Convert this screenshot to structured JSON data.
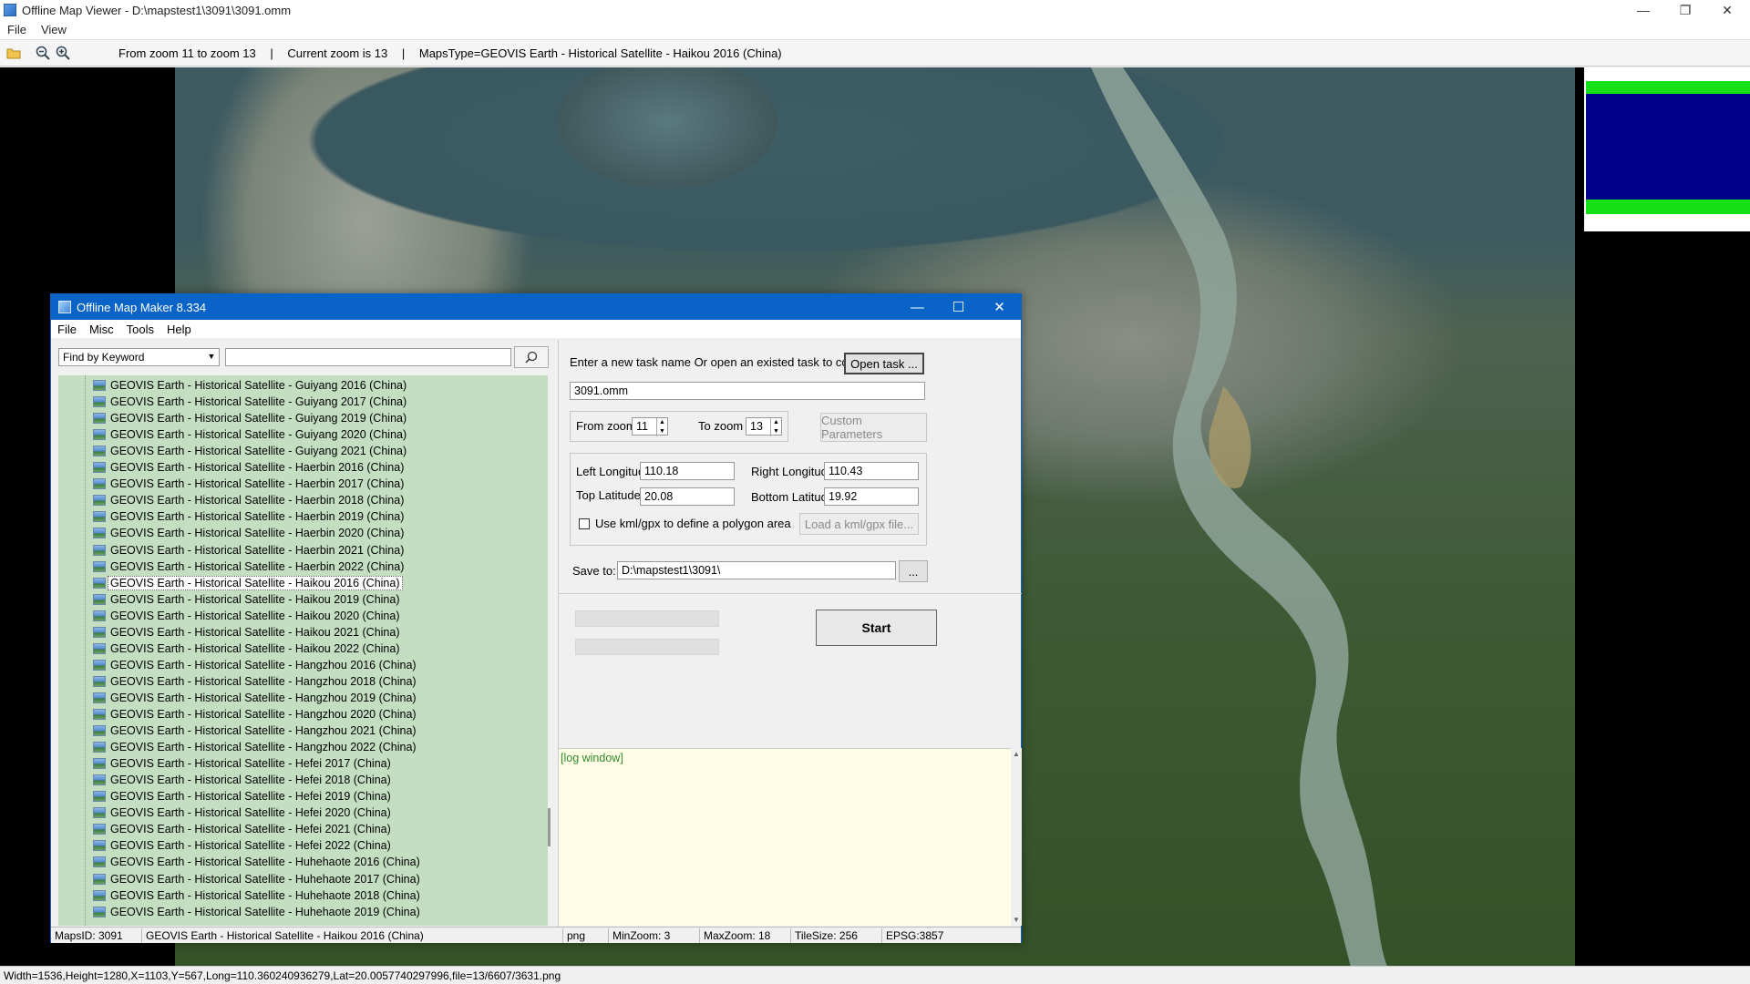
{
  "viewer": {
    "title": "Offline Map Viewer - D:\\mapstest1\\3091\\3091.omm",
    "menu": [
      "File",
      "View"
    ],
    "toolbar": {
      "zoom_range": "From zoom 11 to zoom 13",
      "current_zoom": "Current zoom is 13",
      "maps_type": "MapsType=GEOVIS Earth - Historical Satellite - Haikou 2016 (China)",
      "sep": "|"
    },
    "status": "Width=1536,Height=1280,X=1103,Y=567,Long=110.360240936279,Lat=20.0057740297996,file=13/6607/3631.png",
    "controls": {
      "minimize": "—",
      "restore": "❐",
      "close": "✕"
    }
  },
  "dialog": {
    "title": "Offline Map Maker 8.334",
    "menu": [
      "File",
      "Misc",
      "Tools",
      "Help"
    ],
    "search_mode": "Find by Keyword",
    "map_list": [
      "GEOVIS Earth - Historical Satellite - Guiyang 2016 (China)",
      "GEOVIS Earth - Historical Satellite - Guiyang 2017 (China)",
      "GEOVIS Earth - Historical Satellite - Guiyang 2019 (China)",
      "GEOVIS Earth - Historical Satellite - Guiyang 2020 (China)",
      "GEOVIS Earth - Historical Satellite - Guiyang 2021 (China)",
      "GEOVIS Earth - Historical Satellite - Haerbin 2016 (China)",
      "GEOVIS Earth - Historical Satellite - Haerbin 2017 (China)",
      "GEOVIS Earth - Historical Satellite - Haerbin 2018 (China)",
      "GEOVIS Earth - Historical Satellite - Haerbin 2019 (China)",
      "GEOVIS Earth - Historical Satellite - Haerbin 2020 (China)",
      "GEOVIS Earth - Historical Satellite - Haerbin 2021 (China)",
      "GEOVIS Earth - Historical Satellite - Haerbin 2022 (China)",
      "GEOVIS Earth - Historical Satellite - Haikou 2016 (China)",
      "GEOVIS Earth - Historical Satellite - Haikou 2019 (China)",
      "GEOVIS Earth - Historical Satellite - Haikou 2020 (China)",
      "GEOVIS Earth - Historical Satellite - Haikou 2021 (China)",
      "GEOVIS Earth - Historical Satellite - Haikou 2022 (China)",
      "GEOVIS Earth - Historical Satellite - Hangzhou 2016 (China)",
      "GEOVIS Earth - Historical Satellite - Hangzhou 2018 (China)",
      "GEOVIS Earth - Historical Satellite - Hangzhou 2019 (China)",
      "GEOVIS Earth - Historical Satellite - Hangzhou 2020 (China)",
      "GEOVIS Earth - Historical Satellite - Hangzhou 2021 (China)",
      "GEOVIS Earth - Historical Satellite - Hangzhou 2022 (China)",
      "GEOVIS Earth - Historical Satellite - Hefei 2017 (China)",
      "GEOVIS Earth - Historical Satellite - Hefei 2018 (China)",
      "GEOVIS Earth - Historical Satellite - Hefei 2019 (China)",
      "GEOVIS Earth - Historical Satellite - Hefei 2020 (China)",
      "GEOVIS Earth - Historical Satellite - Hefei 2021 (China)",
      "GEOVIS Earth - Historical Satellite - Hefei 2022 (China)",
      "GEOVIS Earth - Historical Satellite - Huhehaote 2016 (China)",
      "GEOVIS Earth - Historical Satellite - Huhehaote 2017 (China)",
      "GEOVIS Earth - Historical Satellite - Huhehaote 2018 (China)",
      "GEOVIS Earth - Historical Satellite - Huhehaote 2019 (China)"
    ],
    "selected_index": 12,
    "task_prompt": "Enter a new task name Or open an existed task to continue:",
    "open_task_label": "Open task ...",
    "task_name": "3091.omm",
    "from_zoom_label": "From zoom",
    "from_zoom": "11",
    "to_zoom_label": "To zoom",
    "to_zoom": "13",
    "custom_params_label": "Custom Parameters",
    "left_lon_label": "Left Longitude",
    "left_lon": "110.18",
    "right_lon_label": "Right Longitude",
    "right_lon": "110.43",
    "top_lat_label": "Top Latitude",
    "top_lat": "20.08",
    "bottom_lat_label": "Bottom Latitude",
    "bottom_lat": "19.92",
    "kml_label": "Use kml/gpx to define a polygon area",
    "load_kml_label": "Load a kml/gpx file...",
    "save_to_label": "Save to:",
    "save_to": "D:\\mapstest1\\3091\\",
    "browse_label": "...",
    "start_label": "Start",
    "log_text": "[log window]",
    "status": {
      "maps_id": "MapsID: 3091",
      "maps_name": "GEOVIS Earth - Historical Satellite - Haikou 2016 (China)",
      "format": "png",
      "min_zoom": "MinZoom: 3",
      "max_zoom": "MaxZoom: 18",
      "tile_size": "TileSize: 256",
      "epsg": "EPSG:3857"
    }
  }
}
